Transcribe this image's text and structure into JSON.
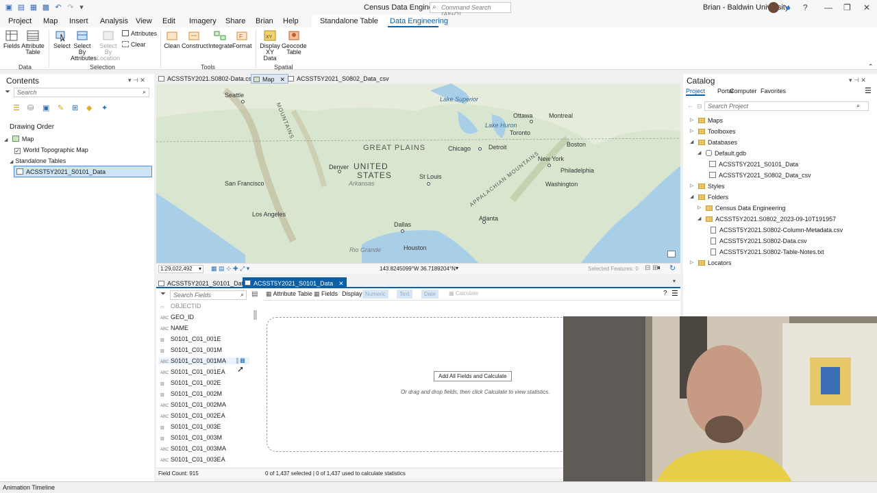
{
  "window": {
    "title": "Census Data Engineering",
    "command_search_placeholder": "Command Search (Alt+Q)",
    "user": "Brian - Baldwin University"
  },
  "ribbon_tabs": [
    "Project",
    "Map",
    "Insert",
    "Analysis",
    "View",
    "Edit",
    "Imagery",
    "Share",
    "Brian",
    "Help",
    "Standalone Table",
    "Data Engineering"
  ],
  "ribbon": {
    "fields": "Fields",
    "attribute_table": "Attribute Table",
    "select": "Select",
    "select_by_attributes": "Select By Attributes",
    "select_by_location": "Select By Location",
    "attributes": "Attributes",
    "clear": "Clear",
    "clean": "Clean",
    "construct": "Construct",
    "integrate": "Integrate",
    "format": "Format",
    "display_xy": "Display XY Data",
    "geocode_table": "Geocode Table",
    "group_data": "Data",
    "group_selection": "Selection",
    "group_tools": "Tools",
    "group_spatial": "Spatial"
  },
  "contents": {
    "title": "Contents",
    "search_placeholder": "Search",
    "drawing_order": "Drawing Order",
    "map": "Map",
    "layer": "World Topographic Map",
    "standalone_tables": "Standalone Tables",
    "selected_table": "ACSST5Y2021_S0101_Data"
  },
  "view_tabs": [
    "ACSST5Y2021.S0802-Data.csv",
    "Map",
    "ACSST5Y2021_S0802_Data_csv"
  ],
  "map": {
    "labels": [
      "Seattle",
      "Ottawa",
      "Montreal",
      "Toronto",
      "Boston",
      "Chicago",
      "Detroit",
      "New York",
      "Philadelphia",
      "Washington",
      "Denver",
      "San Francisco",
      "St Louis",
      "Los Angeles",
      "Dallas",
      "Atlanta",
      "Houston",
      "Lake Superior",
      "Lake Huron",
      "Arkansas",
      "Rio Grande"
    ],
    "big_labels": [
      "GREAT PLAINS",
      "UNITED",
      "STATES",
      "MOUNTAINS",
      "APPALACHIAN MOUNTAINS"
    ],
    "scale": "1:29,022,492",
    "coords": "143.8245099°W 36.7189204°N",
    "selected_features": "Selected Features: 0"
  },
  "table_tabs": [
    "ACSST5Y2021_S0101_Data",
    "ACSST5Y2021_S0101_Data"
  ],
  "fields_view": {
    "search_placeholder": "Search Fields",
    "attribute_table": "Attribute Table",
    "fields": "Fields",
    "display": "Display:",
    "numeric": "Numeric",
    "text": "Text",
    "date": "Date",
    "calculate": "Calculate",
    "field_list": [
      {
        "type": "OID",
        "name": "OBJECTID"
      },
      {
        "type": "ABC",
        "name": "GEO_ID"
      },
      {
        "type": "ABC",
        "name": "NAME"
      },
      {
        "type": "NUM",
        "name": "S0101_C01_001E"
      },
      {
        "type": "NUM",
        "name": "S0101_C01_001M"
      },
      {
        "type": "ABC",
        "name": "S0101_C01_001MA"
      },
      {
        "type": "ABC",
        "name": "S0101_C01_001EA"
      },
      {
        "type": "NUM",
        "name": "S0101_C01_002E"
      },
      {
        "type": "NUM",
        "name": "S0101_C01_002M"
      },
      {
        "type": "ABC",
        "name": "S0101_C01_002MA"
      },
      {
        "type": "ABC",
        "name": "S0101_C01_002EA"
      },
      {
        "type": "NUM",
        "name": "S0101_C01_003E"
      },
      {
        "type": "NUM",
        "name": "S0101_C01_003M"
      },
      {
        "type": "ABC",
        "name": "S0101_C01_003MA"
      },
      {
        "type": "ABC",
        "name": "S0101_C01_003EA"
      }
    ],
    "add_all_button": "Add All Fields and Calculate",
    "hint": "Or drag and drop fields, then click Calculate to view statistics.",
    "field_count": "Field Count: 915",
    "selection_status": "0 of 1,437 selected | 0 of 1,437 used to calculate statistics"
  },
  "catalog": {
    "title": "Catalog",
    "tabs": [
      "Project",
      "Portal",
      "Computer",
      "Favorites"
    ],
    "search_placeholder": "Search Project",
    "items": [
      "Maps",
      "Toolboxes",
      "Databases",
      "Default.gdb",
      "ACSST5Y2021_S0101_Data",
      "ACSST5Y2021_S0802_Data_csv",
      "Styles",
      "Folders",
      "Census Data Engineering",
      "ACSST5Y2021.S0802_2023-09-10T191957",
      "ACSST5Y2021.S0802-Column-Metadata.csv",
      "ACSST5Y2021.S0802-Data.csv",
      "ACSST5Y2021.S0802-Table-Notes.txt",
      "Locators"
    ]
  },
  "animation_timeline": "Animation Timeline"
}
